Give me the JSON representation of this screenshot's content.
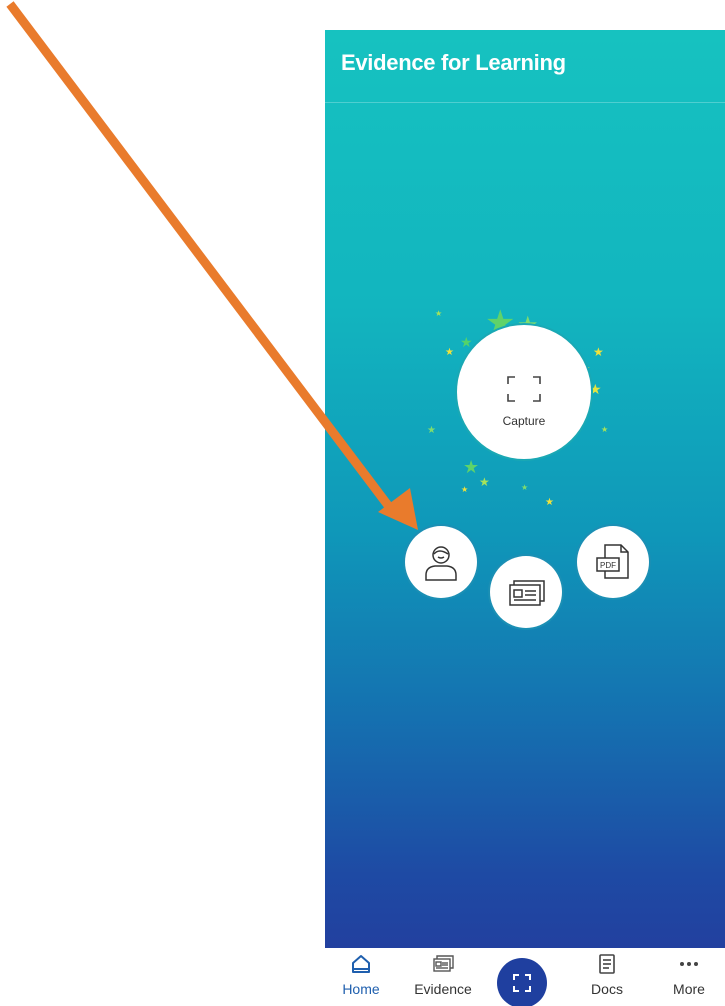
{
  "app": {
    "title": "Evidence for Learning"
  },
  "capture": {
    "label": "Capture"
  },
  "actions": [
    {
      "name": "learner",
      "icon": "learner-profile-icon"
    },
    {
      "name": "evidence",
      "icon": "evidence-card-icon"
    },
    {
      "name": "pdf",
      "icon": "pdf-document-icon",
      "icon_text": "PDF"
    }
  ],
  "nav": {
    "items": [
      {
        "label": "Home",
        "icon": "home-icon",
        "active": true
      },
      {
        "label": "Evidence",
        "icon": "evidence-icon",
        "active": false
      },
      {
        "label": "",
        "icon": "capture-scan-icon",
        "active": false
      },
      {
        "label": "Docs",
        "icon": "docs-icon",
        "active": false
      },
      {
        "label": "More",
        "icon": "more-dots-icon",
        "active": false
      }
    ]
  },
  "colors": {
    "arrow": "#e97b2c",
    "gradient_top": "#16c2c0",
    "gradient_bottom": "#22409f",
    "nav_active": "#1f5fae",
    "nav_center_button": "#1f3f9f"
  }
}
